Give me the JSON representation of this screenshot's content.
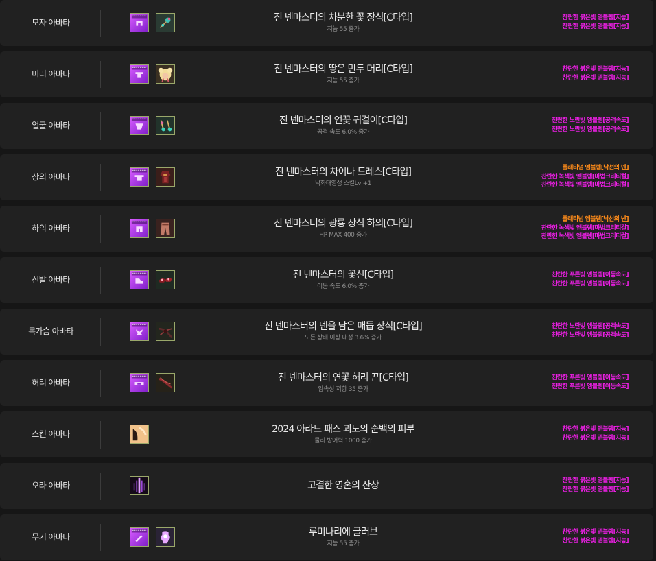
{
  "colors": {
    "bright_emblem": "#ee1fe6",
    "platinum_emblem": "#ff8c1a",
    "row_bg": "#212121",
    "page_bg": "#161616"
  },
  "rows": [
    {
      "slot": "모자 아바타",
      "name": "진 넨마스터의 차분한 꽃 장식[C타입]",
      "option": "지능 55 증가",
      "clone_icon": "clone-hat-icon",
      "item_icon": "flower-ornament-icon",
      "emblems": [
        {
          "text": "찬란한 붉은빛 엠블렘[지능]",
          "kind": "bright"
        },
        {
          "text": "찬란한 붉은빛 엠블렘[지능]",
          "kind": "bright"
        }
      ]
    },
    {
      "slot": "머리 아바타",
      "name": "진 넨마스터의 땋은 만두 머리[C타입]",
      "option": "지능 55 증가",
      "clone_icon": "clone-hair-icon",
      "item_icon": "bun-hair-icon",
      "emblems": [
        {
          "text": "찬란한 붉은빛 엠블렘[지능]",
          "kind": "bright"
        },
        {
          "text": "찬란한 붉은빛 엠블렘[지능]",
          "kind": "bright"
        }
      ]
    },
    {
      "slot": "얼굴 아바타",
      "name": "진 넨마스터의 연꽃 귀걸이[C타입]",
      "option": "공격 속도 6.0% 증가",
      "clone_icon": "clone-face-icon",
      "item_icon": "lotus-earring-icon",
      "emblems": [
        {
          "text": "찬란한 노란빛 엠블렘[공격속도]",
          "kind": "bright"
        },
        {
          "text": "찬란한 노란빛 엠블렘[공격속도]",
          "kind": "bright"
        }
      ]
    },
    {
      "slot": "상의 아바타",
      "name": "진 넨마스터의 차이나 드레스[C타입]",
      "option": "낙화태영성 스킬Lv +1",
      "clone_icon": "clone-top-icon",
      "item_icon": "china-dress-icon",
      "emblems": [
        {
          "text": "플래티넘 엠블렘[낙선의 넨]",
          "kind": "platinum"
        },
        {
          "text": "찬란한 녹색빛 엠블렘[마법크리티컬]",
          "kind": "bright"
        },
        {
          "text": "찬란한 녹색빛 엠블렘[마법크리티컬]",
          "kind": "bright"
        }
      ]
    },
    {
      "slot": "하의 아바타",
      "name": "진 넨마스터의 광룡 장식 하의[C타입]",
      "option": "HP MAX 400 증가",
      "clone_icon": "clone-bottom-icon",
      "item_icon": "dragon-pants-icon",
      "emblems": [
        {
          "text": "플래티넘 엠블렘[낙선의 넨]",
          "kind": "platinum"
        },
        {
          "text": "찬란한 녹색빛 엠블렘[마법크리티컬]",
          "kind": "bright"
        },
        {
          "text": "찬란한 녹색빛 엠블렘[마법크리티컬]",
          "kind": "bright"
        }
      ]
    },
    {
      "slot": "신발 아바타",
      "name": "진 넨마스터의 꽃신[C타입]",
      "option": "이동 속도 6.0% 증가",
      "clone_icon": "clone-shoes-icon",
      "item_icon": "flower-shoes-icon",
      "emblems": [
        {
          "text": "찬란한 푸른빛 엠블렘[이동속도]",
          "kind": "bright"
        },
        {
          "text": "찬란한 푸른빛 엠블렘[이동속도]",
          "kind": "bright"
        }
      ]
    },
    {
      "slot": "목가슴 아바타",
      "name": "진 넨마스터의 넨을 담은 매듭 장식[C타입]",
      "option": "모든 상태 이상 내성 3.6% 증가",
      "clone_icon": "clone-neck-icon",
      "item_icon": "knot-ornament-icon",
      "emblems": [
        {
          "text": "찬란한 노란빛 엠블렘[공격속도]",
          "kind": "bright"
        },
        {
          "text": "찬란한 노란빛 엠블렘[공격속도]",
          "kind": "bright"
        }
      ]
    },
    {
      "slot": "허리 아바타",
      "name": "진 넨마스터의 연꽃 허리 끈[C타입]",
      "option": "암속성 저항 35 증가",
      "clone_icon": "clone-belt-icon",
      "item_icon": "lotus-belt-icon",
      "emblems": [
        {
          "text": "찬란한 푸른빛 엠블렘[이동속도]",
          "kind": "bright"
        },
        {
          "text": "찬란한 푸른빛 엠블렘[이동속도]",
          "kind": "bright"
        }
      ]
    },
    {
      "slot": "스킨 아바타",
      "name": "2024 아라드 패스 괴도의 순백의 피부",
      "option": "물리 방어력 1000 증가",
      "solo_icon": "skin-icon",
      "emblems": [
        {
          "text": "찬란한 붉은빛 엠블렘[지능]",
          "kind": "bright"
        },
        {
          "text": "찬란한 붉은빛 엠블렘[지능]",
          "kind": "bright"
        }
      ]
    },
    {
      "slot": "오라 아바타",
      "name": "고결한 영혼의 잔상",
      "option": "",
      "solo_icon": "aura-icon",
      "emblems": [
        {
          "text": "찬란한 붉은빛 엠블렘[지능]",
          "kind": "bright"
        },
        {
          "text": "찬란한 붉은빛 엠블렘[지능]",
          "kind": "bright"
        }
      ]
    },
    {
      "slot": "무기 아바타",
      "name": "루미나리에 글러브",
      "option": "지능 55 증가",
      "clone_icon": "clone-weapon-icon",
      "item_icon": "glove-icon",
      "emblems": [
        {
          "text": "찬란한 붉은빛 엠블렘[지능]",
          "kind": "bright"
        },
        {
          "text": "찬란한 붉은빛 엠블렘[지능]",
          "kind": "bright"
        }
      ]
    }
  ]
}
